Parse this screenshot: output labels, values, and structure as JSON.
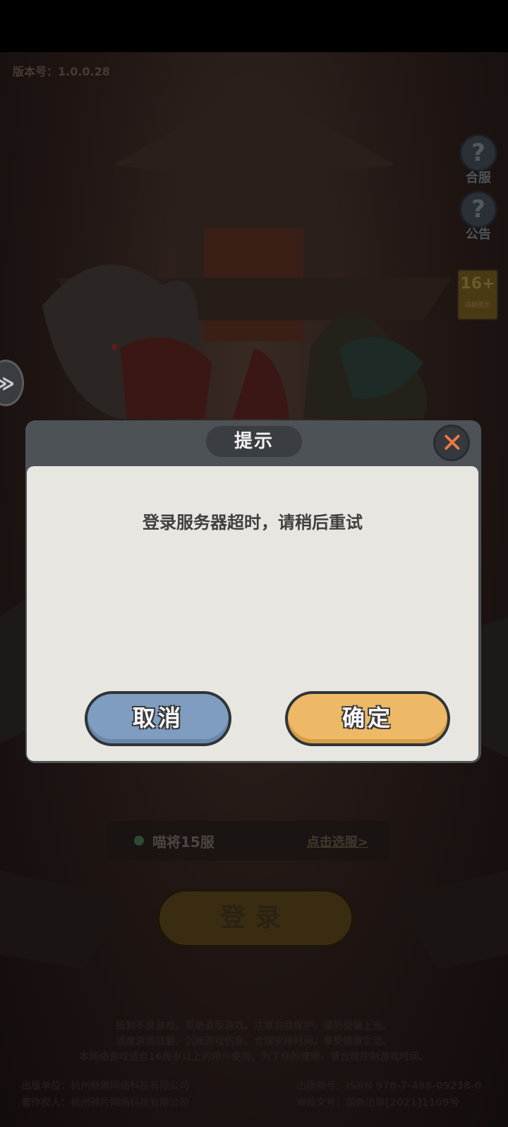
{
  "background": {
    "version_text": "版本号：1.0.0.28",
    "side_buttons": [
      {
        "icon": "question-icon",
        "glyph": "?",
        "label": "合服"
      },
      {
        "icon": "question-icon",
        "glyph": "?",
        "label": "公告"
      }
    ],
    "age_badge": {
      "rating": "16+",
      "label": "适龄提示"
    },
    "server": {
      "name": "喵将15服",
      "select_link": "点击选服>"
    },
    "login_button": "登录",
    "health_notice": [
      "抵制不良游戏，拒绝盗版游戏。注意自我保护，谨防受骗上当。",
      "适度游戏益脑，沉迷游戏伤身。合理安排时间，享受健康生活。",
      "本网络游戏适合16周岁以上的用户使用，为了你的健康，请合理控制游戏时间。"
    ],
    "publisher_left": [
      "出版单位：杭州畅趣网络科技有限公司",
      "著作权人：杭州碎片网络科技有限公司"
    ],
    "publisher_right": [
      "出版物号：ISBN 978-7-498-09238-0",
      "审批文号：国新出审[2021]1109号"
    ]
  },
  "dialog": {
    "title": "提示",
    "close_glyph": "✕",
    "message": "登录服务器超时，请稍后重试",
    "cancel_label": "取消",
    "confirm_label": "确定"
  },
  "side_tab_glyph": "≫",
  "colors": {
    "dialog_body": "#e8e6e1",
    "dialog_frame": "#4d5257",
    "cancel": "#7f9dc1",
    "confirm": "#edb967",
    "close_x": "#f07a43"
  }
}
